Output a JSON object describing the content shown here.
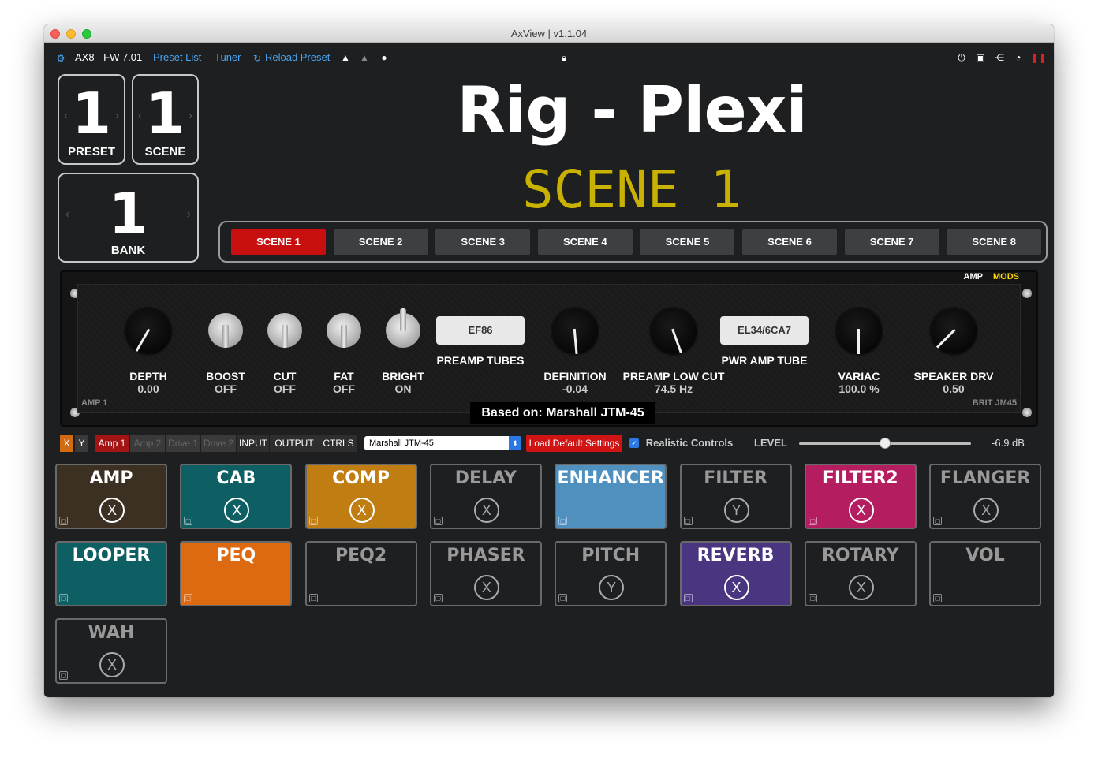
{
  "window": {
    "title": "AxView | v1.1.04"
  },
  "toolbar": {
    "device": "AX8 - FW 7.01",
    "preset_list": "Preset List",
    "tuner": "Tuner",
    "reload": "Reload Preset"
  },
  "counters": {
    "preset": {
      "value": "1",
      "label": "PRESET"
    },
    "scene": {
      "value": "1",
      "label": "SCENE"
    },
    "bank": {
      "value": "1",
      "label": "BANK"
    }
  },
  "preset_name": "Rig - Plexi",
  "scene_name": "SCENE 1",
  "scenes": [
    {
      "label": "SCENE 1",
      "active": true
    },
    {
      "label": "SCENE 2",
      "active": false
    },
    {
      "label": "SCENE 3",
      "active": false
    },
    {
      "label": "SCENE 4",
      "active": false
    },
    {
      "label": "SCENE 5",
      "active": false
    },
    {
      "label": "SCENE 6",
      "active": false
    },
    {
      "label": "SCENE 7",
      "active": false
    },
    {
      "label": "SCENE 8",
      "active": false
    }
  ],
  "amp_panel": {
    "tabs": {
      "amp": "AMP",
      "mods": "MODS"
    },
    "left_tag": "AMP 1",
    "right_tag": "BRIT JM45",
    "based_on": "Based on: Marshall JTM-45",
    "controls": [
      {
        "label": "DEPTH",
        "value": "0.00",
        "type": "knob"
      },
      {
        "label": "BOOST",
        "value": "OFF",
        "type": "toggle"
      },
      {
        "label": "CUT",
        "value": "OFF",
        "type": "toggle"
      },
      {
        "label": "FAT",
        "value": "OFF",
        "type": "toggle"
      },
      {
        "label": "BRIGHT",
        "value": "ON",
        "type": "toggle"
      },
      {
        "label": "PREAMP TUBES",
        "value": "EF86",
        "type": "select"
      },
      {
        "label": "DEFINITION",
        "value": "-0.04",
        "type": "knob"
      },
      {
        "label": "PREAMP LOW CUT",
        "value": "74.5 Hz",
        "type": "knob"
      },
      {
        "label": "PWR AMP TUBE",
        "value": "EL34/6CA7",
        "type": "select"
      },
      {
        "label": "VARIAC",
        "value": "100.0 %",
        "type": "knob"
      },
      {
        "label": "SPEAKER DRV",
        "value": "0.50",
        "type": "knob"
      }
    ]
  },
  "control_bar": {
    "x": "X",
    "y": "Y",
    "amp_tabs": [
      "Amp 1",
      "Amp 2",
      "Drive 1",
      "Drive 2"
    ],
    "views": [
      "INPUT",
      "OUTPUT",
      "CTRLS"
    ],
    "model": "Marshall JTM-45",
    "load_default": "Load Default Settings",
    "realistic": "Realistic Controls",
    "level_label": "LEVEL",
    "level_value": "-6.9 dB",
    "level_fraction": 0.5
  },
  "blocks": [
    {
      "name": "AMP",
      "xy": "X",
      "color": "#3c3022",
      "on": true
    },
    {
      "name": "CAB",
      "xy": "X",
      "color": "#0d5f63",
      "on": true
    },
    {
      "name": "COMP",
      "xy": "X",
      "color": "#c07d12",
      "on": true
    },
    {
      "name": "DELAY",
      "xy": "X",
      "color": "#1d1f21",
      "on": false
    },
    {
      "name": "ENHANCER",
      "xy": "",
      "color": "#4f90bf",
      "on": true
    },
    {
      "name": "FILTER",
      "xy": "Y",
      "color": "#1d1f21",
      "on": false
    },
    {
      "name": "FILTER2",
      "xy": "X",
      "color": "#b41d60",
      "on": true
    },
    {
      "name": "FLANGER",
      "xy": "X",
      "color": "#1d1f21",
      "on": false
    },
    {
      "name": "LOOPER",
      "xy": "",
      "color": "#0d5f63",
      "on": true
    },
    {
      "name": "PEQ",
      "xy": "",
      "color": "#dd6a10",
      "on": true
    },
    {
      "name": "PEQ2",
      "xy": "",
      "color": "#1d1f21",
      "on": false
    },
    {
      "name": "PHASER",
      "xy": "X",
      "color": "#1d1f21",
      "on": false
    },
    {
      "name": "PITCH",
      "xy": "Y",
      "color": "#1d1f21",
      "on": false
    },
    {
      "name": "REVERB",
      "xy": "X",
      "color": "#4a3580",
      "on": true
    },
    {
      "name": "ROTARY",
      "xy": "X",
      "color": "#1d1f21",
      "on": false
    },
    {
      "name": "VOL",
      "xy": "",
      "color": "#1d1f21",
      "on": false
    },
    {
      "name": "WAH",
      "xy": "X",
      "color": "#1d1f21",
      "on": false
    }
  ]
}
